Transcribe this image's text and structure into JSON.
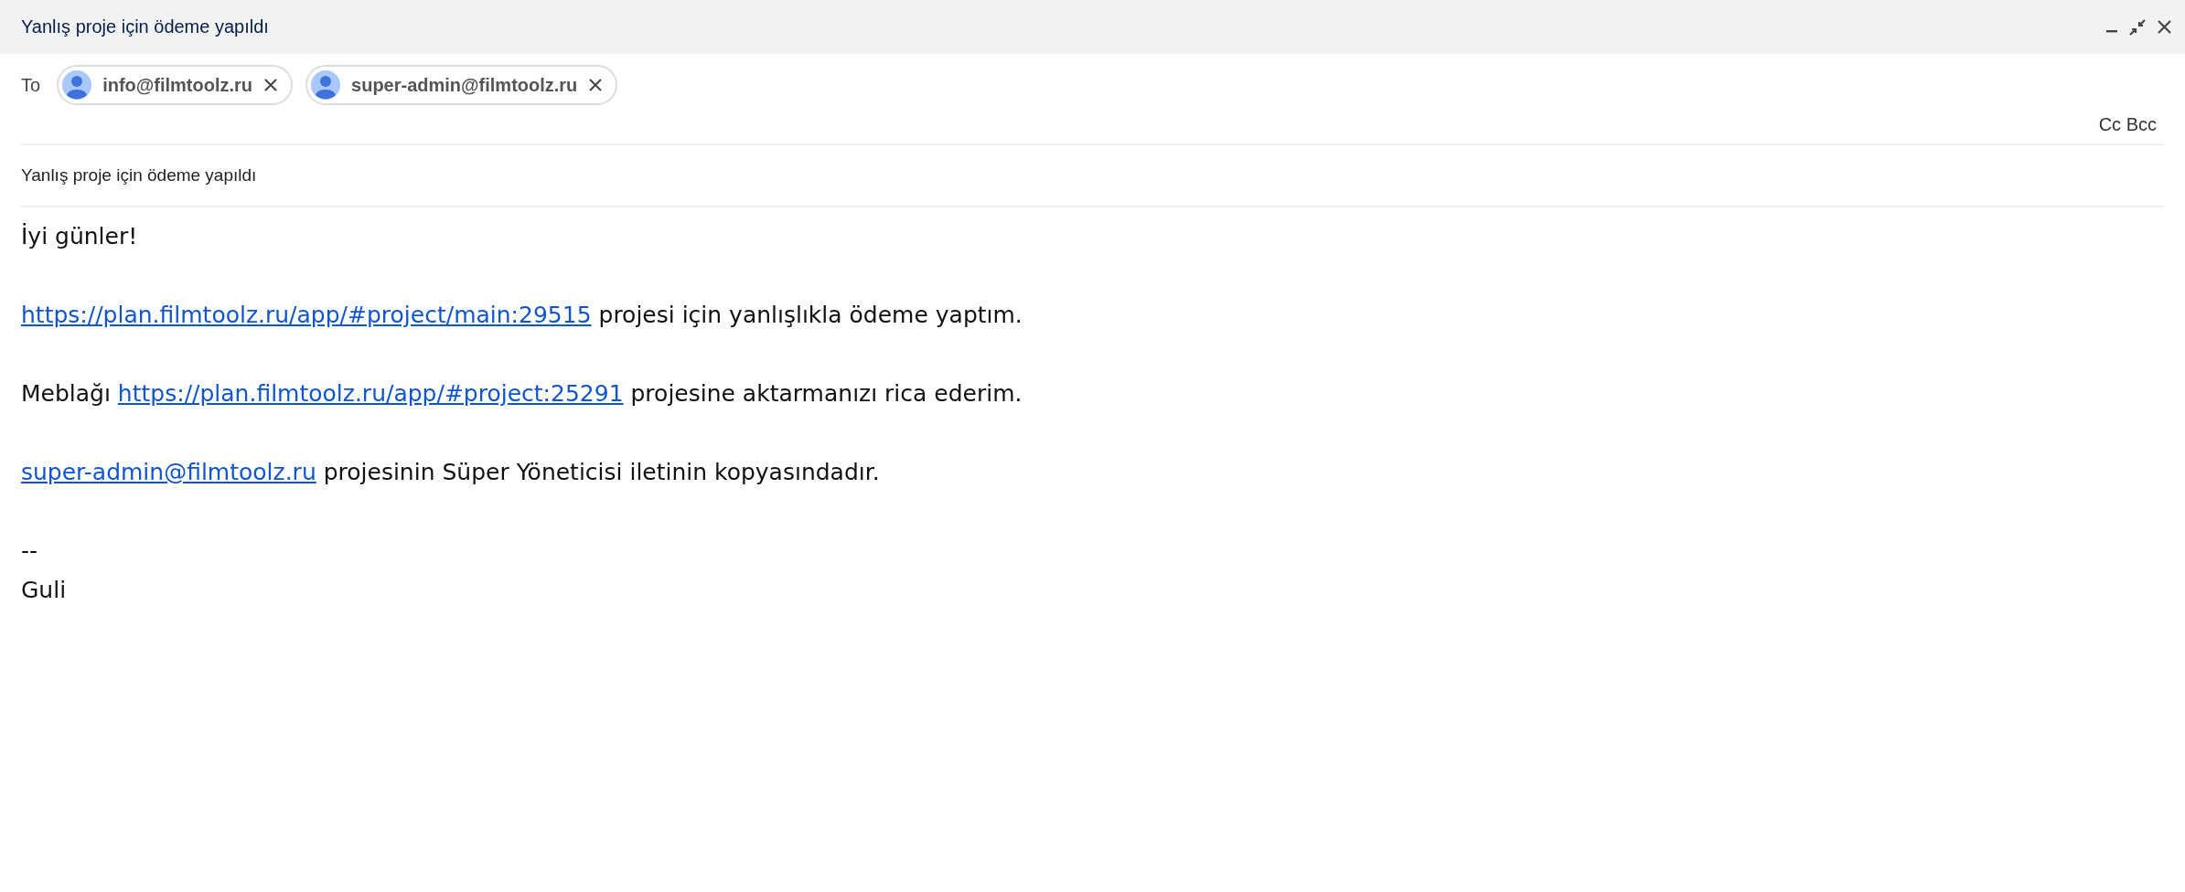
{
  "window": {
    "title": "Yanlış proje için ödeme yapıldı"
  },
  "to_label": "To",
  "recipients": [
    {
      "email": "info@filmtoolz.ru"
    },
    {
      "email": "super-admin@filmtoolz.ru"
    }
  ],
  "cc_bcc": "Cc Bcc",
  "subject": "Yanlış proje için ödeme yapıldı",
  "body": [
    {
      "kind": "paragraph",
      "parts": [
        {
          "kind": "text",
          "text": " İyi günler!"
        }
      ]
    },
    {
      "kind": "paragraph",
      "parts": [
        {
          "kind": "link",
          "text": "https://plan.filmtoolz.ru/app/#project/main:29515"
        },
        {
          "kind": "text",
          "text": " projesi için yanlışlıkla ödeme yaptım."
        }
      ]
    },
    {
      "kind": "paragraph",
      "parts": [
        {
          "kind": "text",
          "text": "Meblağı "
        },
        {
          "kind": "link",
          "text": "https://plan.filmtoolz.ru/app/#project:25291"
        },
        {
          "kind": "text",
          "text": " projesine aktarmanızı rica ederim."
        }
      ]
    },
    {
      "kind": "paragraph",
      "parts": [
        {
          "kind": "link",
          "text": "super-admin@filmtoolz.ru"
        },
        {
          "kind": "text",
          "text": " projesinin Süper Yöneticisi iletinin kopyasındadır."
        }
      ]
    },
    {
      "kind": "signature",
      "lines": [
        "--",
        "Guli"
      ]
    }
  ]
}
